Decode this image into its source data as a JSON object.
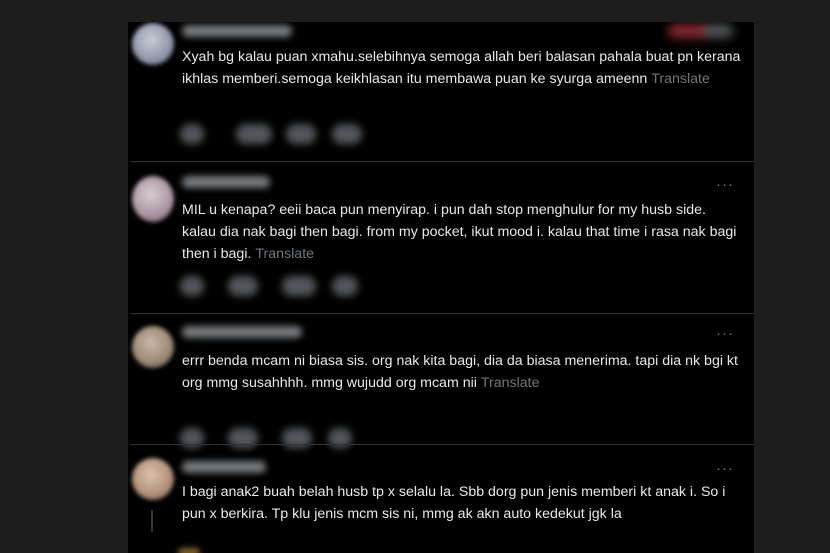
{
  "ui": {
    "more_label": "···",
    "translate_label": "Translate"
  },
  "comments": [
    {
      "text": "Xyah bg kalau puan xmahu.selebihnya semoga allah beri balasan pahala buat pn kerana ikhlas memberi.semoga keikhlasan itu membawa puan ke syurga ameenn",
      "avatar_color": "#9aa0b0"
    },
    {
      "text": "MIL u kenapa? eeii baca pun menyirap. i pun dah stop menghulur for my husb side. kalau dia nak bagi then bagi. from my pocket, ikut mood i. kalau that time i rasa nak bagi then i bagi.",
      "avatar_color": "#b7aab2"
    },
    {
      "text": "errr benda mcam ni biasa sis. org nak kita bagi, dia da biasa menerima. tapi dia nk bgi kt org mmg susahhhh. mmg wujudd org mcam nii",
      "avatar_color": "#a89888"
    },
    {
      "text": "I bagi anak2 buah belah husb tp x selalu la. Sbb dorg pun jenis memberi kt anak i. So i pun x berkira. Tp klu jenis mcm sis ni, mmg ak akn auto kedekut jgk la",
      "avatar_color": "#b89a86"
    }
  ],
  "colors": {
    "background": "#000000",
    "page": "#1d1d1d",
    "text": "#e7e9ea",
    "muted": "#71767b",
    "divider": "#2f3336"
  }
}
